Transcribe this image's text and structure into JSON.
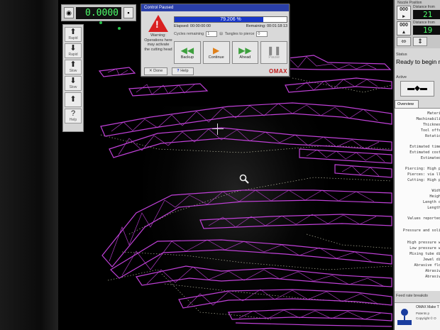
{
  "readout": {
    "value": "0.0000",
    "left_btn": "◉",
    "right_btn": "▪"
  },
  "toolbar": {
    "items": [
      {
        "glyph": "⬆",
        "label": "Rapid"
      },
      {
        "glyph": "⬇",
        "label": "Rapid"
      },
      {
        "glyph": "⬆",
        "label": "Slow"
      },
      {
        "glyph": "⬇",
        "label": "Slow"
      },
      {
        "glyph": "⬆",
        "label": ""
      },
      {
        "glyph": "?",
        "label": "Help"
      }
    ]
  },
  "dialog": {
    "title": "Control Paused",
    "progress_text": "79.206 %",
    "progress_fraction": 0.79206,
    "elapsed": "Elapsed: 00:00:00:00",
    "remaining": "Remaining: 00:01:18:13",
    "cycles_label": "Cycles remaining",
    "cycles_value": "1",
    "tangles_label": "Tangles to pierce",
    "tangles_value": "0",
    "warning_text": "Warning: Operations here may activate the cutting head",
    "buttons": {
      "backup": "Backup",
      "continue": "Continue",
      "ahead": "Ahead",
      "pause": "Pause"
    },
    "done_label": "Done",
    "help_label": "Help",
    "brand": "OMAX"
  },
  "right_panel": {
    "nozzle_label": "Nozzle Position",
    "dist_x_label": "Distance from",
    "dist_y_label": "Distance from",
    "value_x": "21",
    "value_y": "19",
    "status_label": "Status",
    "status_text": "Ready to begin m",
    "active_label": "Active",
    "tab_label": "Overview",
    "list": [
      "Materi",
      "Machinabili",
      "Thicknes",
      "Tool offs",
      "Rotatio",
      "Estimated time",
      "Estimated cost",
      "Estimated",
      "Piercing: High p",
      "Pierces: via ll",
      "Cutting: High p",
      "Widt",
      "Heigh",
      "Length o",
      "Length",
      "Values reported",
      "Pressure and soli",
      "High pressure w",
      "Low pressure w",
      "Mixing tube di",
      "Jewel di",
      "Abrasive flo",
      "Abrasiv",
      "Abrasiv"
    ],
    "footer": "Feed rate breakdo",
    "about_title": "OMAX Make T",
    "about_sub1": "Patents p",
    "about_sub2": "Copyright © O",
    "about_logo": "OMAX"
  },
  "colors": {
    "cut_path": "#c040d8",
    "rapid_path": "#e6e6c8",
    "digits": "#4cff6a",
    "titlebar": "#2a3fa8",
    "warning": "#d92020"
  }
}
